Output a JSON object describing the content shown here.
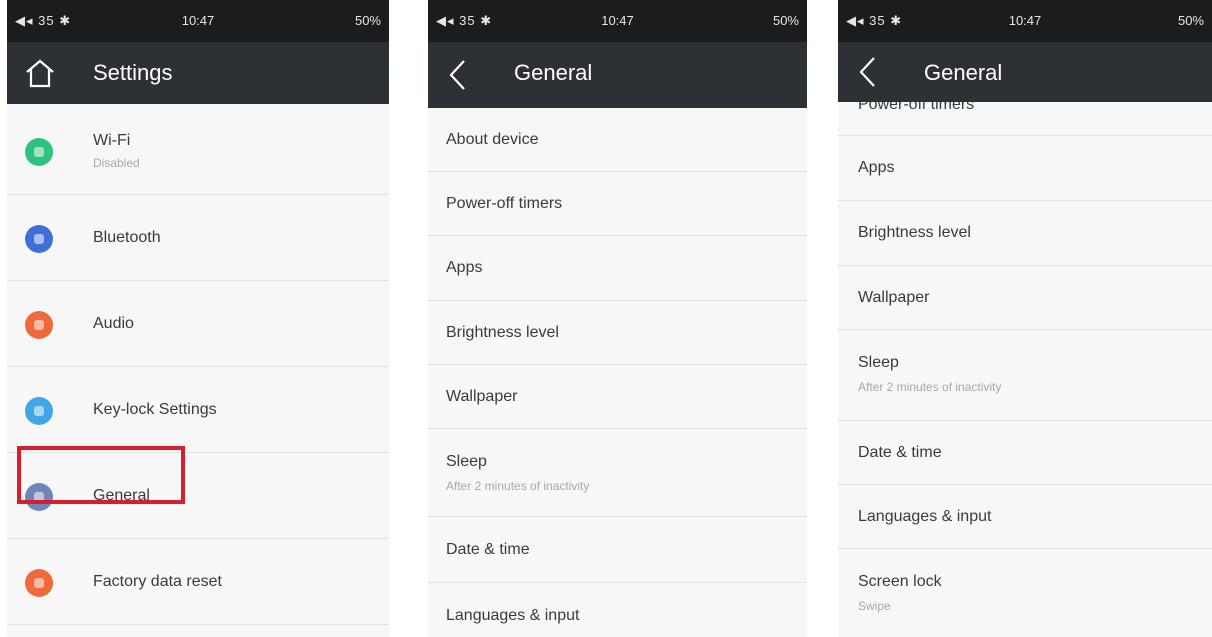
{
  "colors": {
    "statusbar": "#1c1c1c",
    "titlebar": "#2d3136",
    "highlight": "#d81e2c",
    "wifi_icon": "#2ec27e",
    "bluetooth_icon": "#3f6fd8",
    "audio_icon": "#ef6a3a",
    "keylock_icon": "#3fa7e6",
    "general_icon": "#7285b8",
    "factory_icon": "#ef6a3a"
  },
  "screens": [
    {
      "status": {
        "left": "◀◂ 35 ✱",
        "time": "10:47",
        "battery": "50%"
      },
      "header": {
        "title": "Settings",
        "icon": "home-icon"
      },
      "items": [
        {
          "label": "Wi-Fi",
          "sub": "Disabled",
          "icon": "wifi-icon"
        },
        {
          "label": "Bluetooth",
          "icon": "bluetooth-icon"
        },
        {
          "label": "Audio",
          "icon": "audio-icon"
        },
        {
          "label": "Key-lock Settings",
          "icon": "key-lock-icon"
        },
        {
          "label": "General",
          "icon": "general-icon"
        },
        {
          "label": "Factory data reset",
          "icon": "factory-reset-icon"
        }
      ]
    },
    {
      "status": {
        "left": "◀◂ 35 ✱",
        "time": "10:47",
        "battery": "50%"
      },
      "header": {
        "title": "General",
        "icon": "back-arrow-icon"
      },
      "items": [
        {
          "label": "About device"
        },
        {
          "label": "Power-off timers"
        },
        {
          "label": "Apps"
        },
        {
          "label": "Brightness level"
        },
        {
          "label": "Wallpaper"
        },
        {
          "label": "Sleep",
          "sub": "After 2 minutes of inactivity"
        },
        {
          "label": "Date & time"
        },
        {
          "label": "Languages & input"
        }
      ]
    },
    {
      "status": {
        "left": "◀◂ 35 ✱",
        "time": "10:47",
        "battery": "50%"
      },
      "header": {
        "title": "General",
        "icon": "back-arrow-icon"
      },
      "items": [
        {
          "label": "Power-off timers"
        },
        {
          "label": "Apps"
        },
        {
          "label": "Brightness level"
        },
        {
          "label": "Wallpaper"
        },
        {
          "label": "Sleep",
          "sub": "After 2 minutes of inactivity"
        },
        {
          "label": "Date & time"
        },
        {
          "label": "Languages & input"
        },
        {
          "label": "Screen lock",
          "sub": "Swipe"
        }
      ]
    }
  ]
}
